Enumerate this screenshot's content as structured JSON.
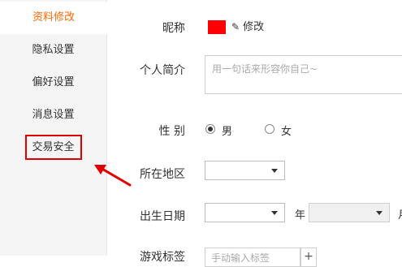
{
  "sidebar": {
    "items": [
      {
        "label": "资料修改",
        "active": true
      },
      {
        "label": "隐私设置",
        "active": false
      },
      {
        "label": "偏好设置",
        "active": false
      },
      {
        "label": "消息设置",
        "active": false
      },
      {
        "label": "交易安全",
        "active": false
      }
    ]
  },
  "form": {
    "nickname_label": "昵称",
    "edit_label": "修改",
    "intro_label": "个人简介",
    "intro_placeholder": "用一句话来形容你自己~",
    "gender_label": "性 别",
    "gender_options": [
      {
        "label": "男",
        "checked": true
      },
      {
        "label": "女",
        "checked": false
      }
    ],
    "location_label": "所在地区",
    "birthday_label": "出生日期",
    "year_unit": "年",
    "month_unit_partial": "月",
    "tags_label": "游戏标签",
    "tags_placeholder": "手动输入标签",
    "tags_add": "+"
  },
  "colors": {
    "accent": "#ff6a00",
    "highlight": "#e00000",
    "sidebar_bg": "#f5f5f5"
  }
}
